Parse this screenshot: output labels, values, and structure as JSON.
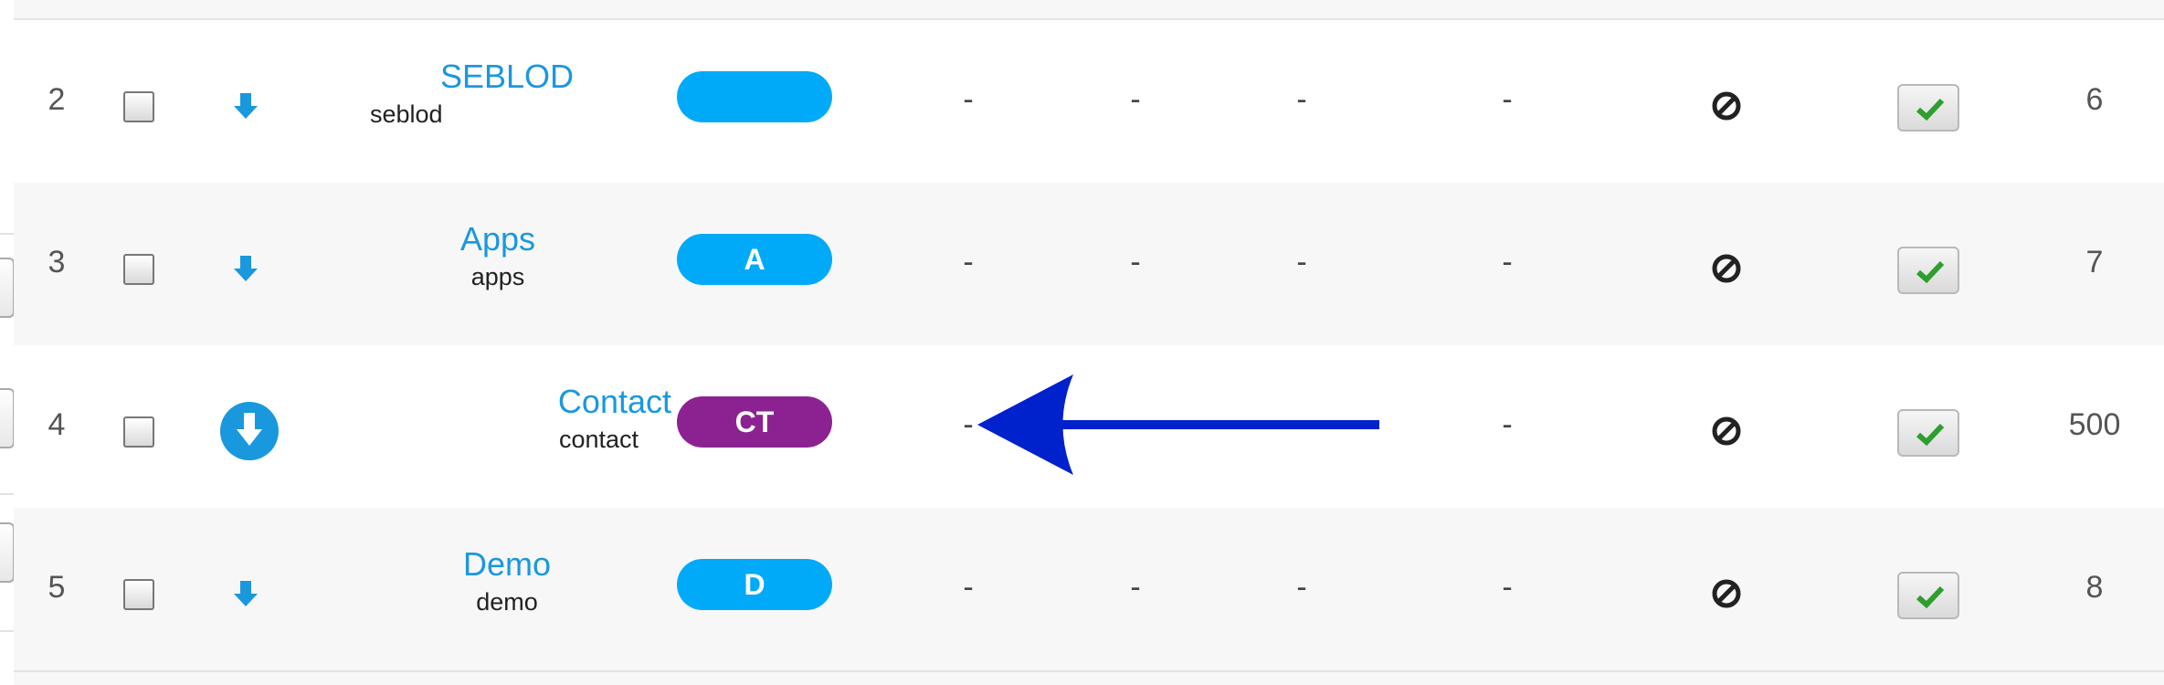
{
  "colors": {
    "link": "#1a98dd",
    "pill_default": "#00aaf8",
    "pill_contact": "#8c2291",
    "annotation_arrow": "#0022cc",
    "check_green": "#2e9e2e"
  },
  "rows": [
    {
      "order": "2",
      "title": "SEBLOD",
      "alias": "seblod",
      "badge": "",
      "badge_color": "#00aaf8",
      "col1": "-",
      "col2": "-",
      "col3": "-",
      "col4": "-",
      "status_icon": "ban-icon",
      "published_icon": "check-icon",
      "id": "6",
      "download_icon": "arrow-down-icon"
    },
    {
      "order": "3",
      "title": "Apps",
      "alias": "apps",
      "badge": "A",
      "badge_color": "#00aaf8",
      "col1": "-",
      "col2": "-",
      "col3": "-",
      "col4": "-",
      "status_icon": "ban-icon",
      "published_icon": "check-icon",
      "id": "7",
      "download_icon": "arrow-down-icon"
    },
    {
      "order": "4",
      "title": "Contact",
      "alias": "contact",
      "badge": "CT",
      "badge_color": "#8c2291",
      "col1": "-",
      "col4": "-",
      "status_icon": "ban-icon",
      "published_icon": "check-icon",
      "id": "500",
      "download_icon": "arrow-down-circle-icon"
    },
    {
      "order": "5",
      "title": "Demo",
      "alias": "demo",
      "badge": "D",
      "badge_color": "#00aaf8",
      "col1": "-",
      "col2": "-",
      "col3": "-",
      "col4": "-",
      "status_icon": "ban-icon",
      "published_icon": "check-icon",
      "id": "8",
      "download_icon": "arrow-down-icon"
    }
  ]
}
